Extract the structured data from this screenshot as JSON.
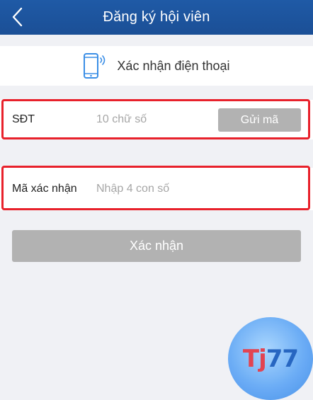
{
  "navbar": {
    "title": "Đăng ký hội viên"
  },
  "header": {
    "title": "Xác nhận điện thoại"
  },
  "phone_field": {
    "label": "SĐT",
    "placeholder": "10 chữ số",
    "send_label": "Gửi mã"
  },
  "code_field": {
    "label": "Mã xác nhận",
    "placeholder": "Nhập 4 con số"
  },
  "confirm": {
    "label": "Xác nhận"
  },
  "watermark": {
    "text_t": "Tj",
    "text_n": "77"
  },
  "colors": {
    "navbar": "#1b4f96",
    "highlight": "#e8212b",
    "button_disabled": "#b2b2b2",
    "background": "#f0f1f5"
  },
  "icons": {
    "back": "chevron-left-icon",
    "phone": "mobile-phone-icon"
  }
}
